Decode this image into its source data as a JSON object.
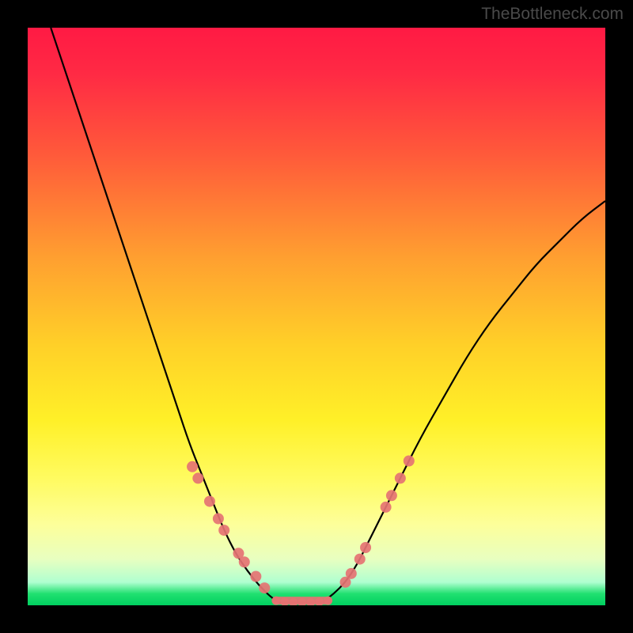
{
  "watermark": "TheBottleneck.com",
  "colors": {
    "background": "#000000",
    "gradient_top": "#ff1a44",
    "gradient_bottom": "#00d060",
    "curve": "#000000",
    "dots": "#e57373"
  },
  "chart_data": {
    "type": "line",
    "title": "",
    "xlabel": "",
    "ylabel": "",
    "xlim": [
      0,
      100
    ],
    "ylim": [
      0,
      100
    ],
    "series": [
      {
        "name": "left-curve",
        "x": [
          4,
          8,
          12,
          16,
          20,
          22,
          24,
          26,
          28,
          30,
          32,
          34,
          36,
          38,
          40,
          42,
          43.5
        ],
        "y": [
          100,
          88,
          76,
          64,
          52,
          46,
          40,
          34,
          28,
          23,
          18,
          13,
          9,
          6,
          3.5,
          1.5,
          0.5
        ]
      },
      {
        "name": "right-curve",
        "x": [
          51,
          53,
          55,
          57,
          59,
          61,
          64,
          68,
          72,
          76,
          80,
          84,
          88,
          92,
          96,
          100
        ],
        "y": [
          0.5,
          2,
          4,
          7,
          11,
          15,
          21,
          29,
          36,
          43,
          49,
          54,
          59,
          63,
          67,
          70
        ]
      },
      {
        "name": "flat-bottom",
        "x": [
          43.5,
          51
        ],
        "y": [
          0.5,
          0.5
        ]
      }
    ],
    "highlighted_points": {
      "left_branch": [
        {
          "x": 28.5,
          "y": 24
        },
        {
          "x": 29.5,
          "y": 22
        },
        {
          "x": 31.5,
          "y": 18
        },
        {
          "x": 33,
          "y": 15
        },
        {
          "x": 34,
          "y": 13
        },
        {
          "x": 36.5,
          "y": 9
        },
        {
          "x": 37.5,
          "y": 7.5
        },
        {
          "x": 39.5,
          "y": 5
        },
        {
          "x": 41,
          "y": 3
        }
      ],
      "bottom_band": [
        {
          "x": 43,
          "y": 0.8
        },
        {
          "x": 44.5,
          "y": 0.6
        },
        {
          "x": 46,
          "y": 0.5
        },
        {
          "x": 47.5,
          "y": 0.5
        },
        {
          "x": 49,
          "y": 0.5
        },
        {
          "x": 50.5,
          "y": 0.6
        },
        {
          "x": 52,
          "y": 0.8
        }
      ],
      "right_branch": [
        {
          "x": 55,
          "y": 4
        },
        {
          "x": 56,
          "y": 5.5
        },
        {
          "x": 57.5,
          "y": 8
        },
        {
          "x": 58.5,
          "y": 10
        },
        {
          "x": 62,
          "y": 17
        },
        {
          "x": 63,
          "y": 19
        },
        {
          "x": 64.5,
          "y": 22
        },
        {
          "x": 66,
          "y": 25
        }
      ]
    }
  }
}
